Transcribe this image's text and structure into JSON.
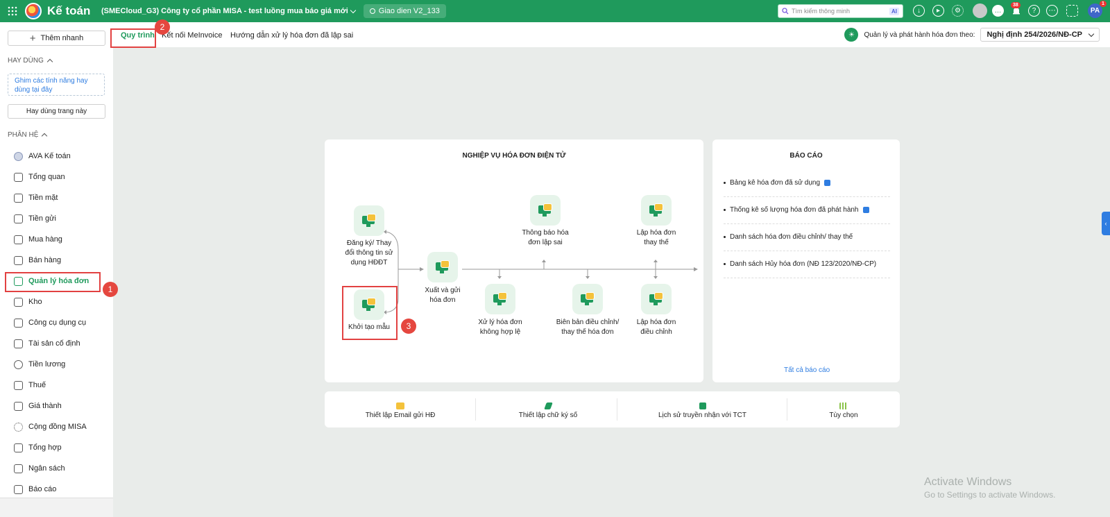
{
  "topbar": {
    "app_name": "Kế toán",
    "company": "(SMECloud_G3) Công ty cổ phần MISA - test luồng mua báo giá mới",
    "version": "Giao dien V2_133",
    "search_placeholder": "Tìm kiếm thông minh",
    "ai_label": "AI",
    "notif_count": "38",
    "user_initials": "PA",
    "user_badge": "1",
    "color": "#1f9a5c"
  },
  "sidebar": {
    "add_quick": "Thêm nhanh",
    "favorites_title": "HAY DÙNG",
    "pin_hint": "Ghim các tính năng hay dùng tại đây",
    "use_page": "Hay dùng trang này",
    "modules_title": "PHÂN HỆ",
    "items": [
      {
        "label": "AVA Kế toán"
      },
      {
        "label": "Tổng quan"
      },
      {
        "label": "Tiền mặt"
      },
      {
        "label": "Tiền gửi"
      },
      {
        "label": "Mua hàng"
      },
      {
        "label": "Bán hàng"
      },
      {
        "label": "Quản lý hóa đơn"
      },
      {
        "label": "Kho"
      },
      {
        "label": "Công cụ dụng cụ"
      },
      {
        "label": "Tài sản cố định"
      },
      {
        "label": "Tiền lương"
      },
      {
        "label": "Thuế"
      },
      {
        "label": "Giá thành"
      },
      {
        "label": "Cộng đồng MISA"
      },
      {
        "label": "Tổng hợp"
      },
      {
        "label": "Ngân sách"
      },
      {
        "label": "Báo cáo"
      }
    ]
  },
  "tabs": [
    {
      "label": "Quy trình"
    },
    {
      "label": "Kết nối MeInvoice"
    },
    {
      "label": "Hướng dẫn xử lý hóa đơn đã lập sai"
    }
  ],
  "regulation": {
    "label": "Quản lý và phát hành hóa đơn theo:",
    "value": "Nghị định 254/2026/NĐ-CP"
  },
  "process": {
    "title": "NGHIỆP VỤ HÓA ĐƠN ĐIỆN TỬ",
    "nodes": {
      "register": "Đăng ký/ Thay đổi thông tin sử dụng HĐĐT",
      "template": "Khởi tạo mẫu",
      "issue": "Xuất và gửi hóa đơn",
      "notify_wrong": "Thông báo hóa đơn lập sai",
      "replace": "Lập hóa đơn thay thế",
      "invalid": "Xử lý hóa đơn không hợp lệ",
      "minutes": "Biên bản điều chỉnh/ thay thế hóa đơn",
      "adjust": "Lập hóa đơn điều chỉnh"
    }
  },
  "reports": {
    "title": "BÁO CÁO",
    "items": [
      {
        "label": "Bảng kê hóa đơn đã sử dụng"
      },
      {
        "label": "Thống kê số lượng hóa đơn đã phát hành"
      },
      {
        "label": "Danh sách hóa đơn điều chỉnh/ thay thế"
      },
      {
        "label": "Danh sách Hủy hóa đơn (NĐ 123/2020/NĐ-CP)"
      }
    ],
    "all": "Tất cả báo cáo"
  },
  "footer": {
    "email": "Thiết lập Email gửi HĐ",
    "signature": "Thiết lập chữ ký số",
    "history": "Lịch sử truyền nhận với TCT",
    "options": "Tùy chọn"
  },
  "annotations": {
    "step1": "1",
    "step2": "2",
    "step3": "3"
  },
  "watermark": {
    "line1": "Activate Windows",
    "line2": "Go to Settings to activate Windows."
  }
}
